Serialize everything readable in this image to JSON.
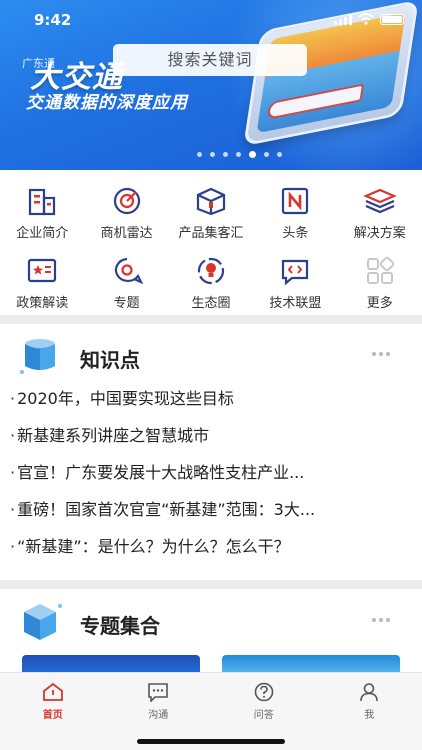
{
  "status": {
    "time": "9:42"
  },
  "banner": {
    "brand_small": "广东通",
    "brand_big": "大交通",
    "subtitle": "交通数据的深度应用",
    "search_placeholder": "搜索关键词",
    "dot_count": 7,
    "active_dot": 4
  },
  "grid": {
    "row1": [
      {
        "label": "企业简介",
        "icon": "building-icon"
      },
      {
        "label": "商机雷达",
        "icon": "radar-icon"
      },
      {
        "label": "产品集客汇",
        "icon": "box-icon"
      },
      {
        "label": "头条",
        "icon": "headline-n-icon"
      },
      {
        "label": "解决方案",
        "icon": "layers-icon"
      }
    ],
    "row2": [
      {
        "label": "政策解读",
        "icon": "policy-book-icon"
      },
      {
        "label": "专题",
        "icon": "topic-bubble-icon"
      },
      {
        "label": "生态圈",
        "icon": "ecosystem-bulb-icon"
      },
      {
        "label": "技术联盟",
        "icon": "code-chat-icon"
      },
      {
        "label": "更多",
        "icon": "grid-more-icon"
      }
    ]
  },
  "knowledge": {
    "title": "知识点",
    "items": [
      "2020年，中国要实现这些目标",
      "新基建系列讲座之智慧城市",
      "官宣！广东要发展十大战略性支柱产业...",
      "重磅！国家首次官宣“新基建”范围：3大...",
      "“新基建”：是什么？为什么？怎么干？"
    ]
  },
  "topics": {
    "title": "专题集合"
  },
  "tabbar": {
    "tabs": [
      {
        "label": "首页",
        "icon": "home-icon",
        "active": true
      },
      {
        "label": "沟通",
        "icon": "chat-icon",
        "active": false
      },
      {
        "label": "问答",
        "icon": "question-icon",
        "active": false
      },
      {
        "label": "我",
        "icon": "user-icon",
        "active": false
      }
    ]
  },
  "colors": {
    "accent_blue": "#1f6fe0",
    "icon_red": "#d9352b",
    "icon_navy": "#2b3f8f",
    "divider": "#ececec"
  }
}
